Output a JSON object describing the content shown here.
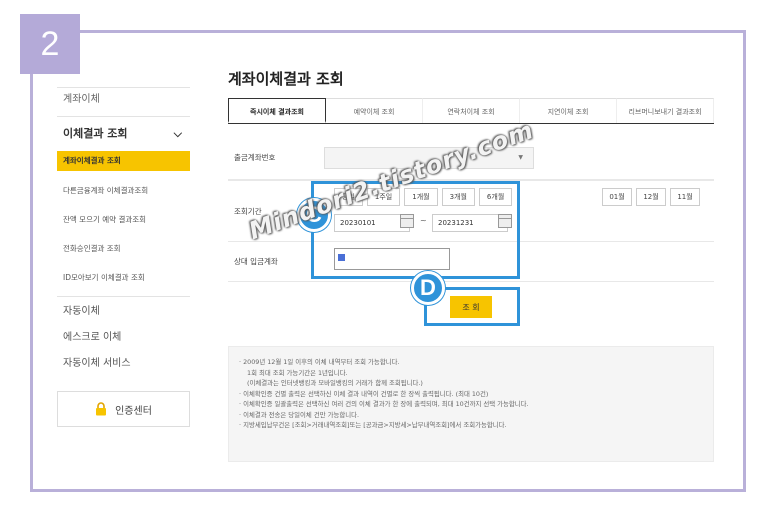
{
  "step_number": "2",
  "page_title": "계좌이체결과 조회",
  "sidebar": {
    "top_item": "계좌이체",
    "section_title": "이체결과 조회",
    "sub_items": [
      {
        "label": "계좌이체결과 조회",
        "active": true
      },
      {
        "label": "다른금융계좌 이체결과조회",
        "active": false
      },
      {
        "label": "잔액 모으기 예약 결과조회",
        "active": false
      },
      {
        "label": "전화승인결과 조회",
        "active": false
      },
      {
        "label": "ID모아보기 이체결과 조회",
        "active": false
      }
    ],
    "links": [
      "자동이체",
      "에스크로 이체",
      "자동이체 서비스"
    ],
    "cert_button": "인증센터",
    "cert_icon": "lock-icon"
  },
  "tabs": [
    {
      "label": "즉시이체 결과조회",
      "active": true
    },
    {
      "label": "예약이체 조회",
      "active": false
    },
    {
      "label": "연락처이체 조회",
      "active": false
    },
    {
      "label": "지연이체 조회",
      "active": false
    },
    {
      "label": "리브머니보내기 결과조회",
      "active": false
    }
  ],
  "form": {
    "account_label": "출금계좌번호",
    "account_dropdown_arrow": "▼",
    "period_label": "조회기간",
    "period_buttons": [
      "당일",
      "1주일",
      "1개월",
      "3개월",
      "6개월"
    ],
    "month_buttons": [
      "01월",
      "12월",
      "11월"
    ],
    "start_date": "20230101",
    "end_date": "20231231",
    "tilde": "~",
    "status_label": "상대 입금계좌"
  },
  "query_button": "조 회",
  "notices": [
    "· 2009년 12월 1일 이후의 이체 내역부터 조회 가능합니다.",
    "1회 최대 조회 가능기간은 1년입니다.",
    "(이체결과는 인터넷뱅킹과 모바일뱅킹의 거래가 함께 조회됩니다.)",
    "· 이체확인증 건별 출력은 선택하신 이체 결과 내역이 건별로 한 장씩 출력됩니다. (최대 10건)",
    "· 이체확인증 일괄출력은 선택하신 여러 건의 이체 결과가 한 장에 출력되며, 최대 10건까지 선택 가능합니다.",
    "· 이체결과 전송은 당일이체 건만 가능합니다.",
    "· 지방세입납부건은 [조회>거래내역조회]또는 [공과금>지방세>납부내역조회]에서 조회가능합니다."
  ],
  "markers": {
    "c": "C",
    "d": "D"
  },
  "watermark": "Mindori2.tistory.com",
  "colors": {
    "accent_yellow": "#f7c400",
    "frame_purple": "#b9b0d9",
    "marker_blue": "#2f93d9"
  }
}
